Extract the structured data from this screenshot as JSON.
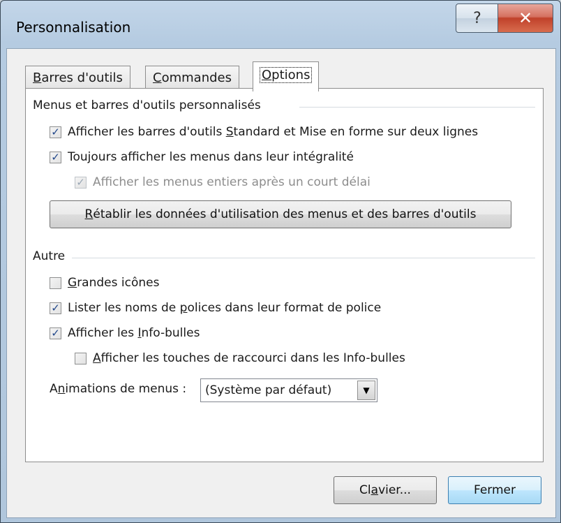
{
  "window": {
    "title": "Personnalisation",
    "help_glyph": "?",
    "close_glyph": "✕"
  },
  "tabs": [
    {
      "label": "Barres d'outils",
      "mnemonic": "B",
      "rest": "arres d'outils",
      "active": false
    },
    {
      "label": "Commandes",
      "mnemonic": "C",
      "rest": "ommandes",
      "active": false
    },
    {
      "label": "Options",
      "mnemonic": "O",
      "rest": "ptions",
      "active": true
    }
  ],
  "menus_group": {
    "title": "Menus et barres d'outils personnalisés",
    "options": [
      {
        "pre": "Afficher les barres d'outils ",
        "mn": "S",
        "post": "tandard et Mise en forme sur deux lignes",
        "checked": true,
        "enabled": true
      },
      {
        "pre": "Tou",
        "mn": "j",
        "post": "ours afficher les menus dans leur intégralité",
        "checked": true,
        "enabled": true
      },
      {
        "pre": "Afficher les menus entiers après un court délai",
        "mn": "",
        "post": "",
        "checked": true,
        "enabled": false
      }
    ],
    "reset_button": {
      "pre": "",
      "mn": "R",
      "post": "établir les données d'utilisation des menus et des barres d'outils"
    }
  },
  "other_group": {
    "title": "Autre",
    "options": [
      {
        "pre": "",
        "mn": "G",
        "post": "randes icônes",
        "checked": false,
        "enabled": true
      },
      {
        "pre": "Lister les noms de ",
        "mn": "p",
        "post": "olices dans leur format de police",
        "checked": true,
        "enabled": true
      },
      {
        "pre": "Afficher les ",
        "mn": "I",
        "post": "nfo-bulles",
        "checked": true,
        "enabled": true
      },
      {
        "pre": "",
        "mn": "A",
        "post": "fficher les touches de raccourci dans les Info-bulles",
        "checked": false,
        "enabled": true
      }
    ],
    "animations": {
      "label_pre": "A",
      "label_mn": "n",
      "label_post": "imations de menus :",
      "value": "(Système par défaut)"
    }
  },
  "footer": {
    "keyboard_button": {
      "pre": "Cl",
      "mn": "a",
      "post": "vier..."
    },
    "close_button": "Fermer"
  },
  "check_glyph": "✓",
  "dropdown_glyph": "▼"
}
